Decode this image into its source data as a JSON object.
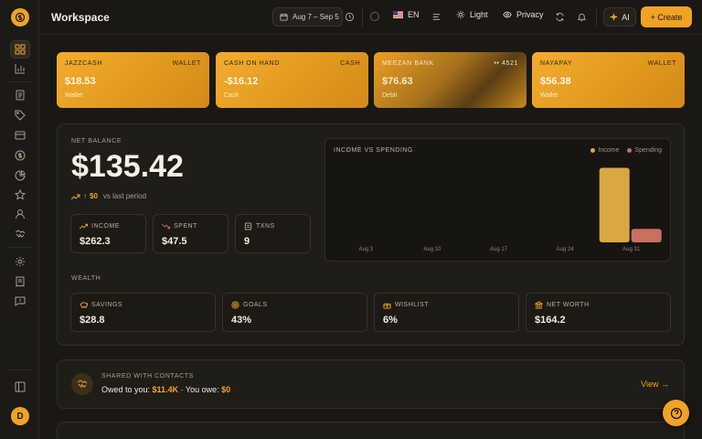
{
  "app": {
    "title": "Workspace",
    "avatar_initial": "D"
  },
  "header": {
    "date_range": "Aug 7 – Sep 5",
    "language": "EN",
    "theme_label": "Light",
    "privacy_label": "Privacy",
    "ai_label": "AI",
    "create_label": "+ Create"
  },
  "wallets": [
    {
      "name": "JAZZCASH",
      "type": "WALLET",
      "amount": "$18.53",
      "subtitle": "Wallet"
    },
    {
      "name": "CASH ON HAND",
      "type": "CASH",
      "amount": "-$16.12",
      "subtitle": "Cash"
    },
    {
      "name": "MEEZAN BANK",
      "type": "•• 4521",
      "amount": "$76.63",
      "subtitle": "Debit"
    },
    {
      "name": "NAYAPAY",
      "type": "WALLET",
      "amount": "$56.38",
      "subtitle": "Wallet"
    }
  ],
  "net_balance": {
    "label": "NET BALANCE",
    "value": "$135.42",
    "delta": "$0",
    "delta_suffix": "vs last period"
  },
  "stats": [
    {
      "label": "INCOME",
      "value": "$262.3"
    },
    {
      "label": "SPENT",
      "value": "$47.5"
    },
    {
      "label": "TXNS",
      "value": "9"
    }
  ],
  "wealth": {
    "label": "WEALTH",
    "items": [
      {
        "label": "SAVINGS",
        "value": "$28.8"
      },
      {
        "label": "GOALS",
        "value": "43%"
      },
      {
        "label": "WISHLIST",
        "value": "6%"
      },
      {
        "label": "NET WORTH",
        "value": "$164.2"
      }
    ]
  },
  "chart_data": {
    "type": "bar",
    "title": "INCOME VS SPENDING",
    "categories": [
      "Aug 3",
      "Aug 10",
      "Aug 17",
      "Aug 24",
      "Aug 31"
    ],
    "series": [
      {
        "name": "Income",
        "color": "#d9a840",
        "values": [
          0,
          0,
          0,
          0,
          262.3
        ]
      },
      {
        "name": "Spending",
        "color": "#c9705f",
        "values": [
          0,
          0,
          0,
          0,
          47.5
        ]
      }
    ],
    "ylim": [
      0,
      280
    ],
    "grid": false,
    "legend": "top-right"
  },
  "shared": {
    "title": "SHARED WITH CONTACTS",
    "owed_label": "Owed to you:",
    "owed_value": "$11.4K",
    "separator": " · You owe: ",
    "owe_value": "$0",
    "view_label": "View →"
  },
  "colors": {
    "accent": "#f0a324",
    "background": "#1a1814"
  }
}
